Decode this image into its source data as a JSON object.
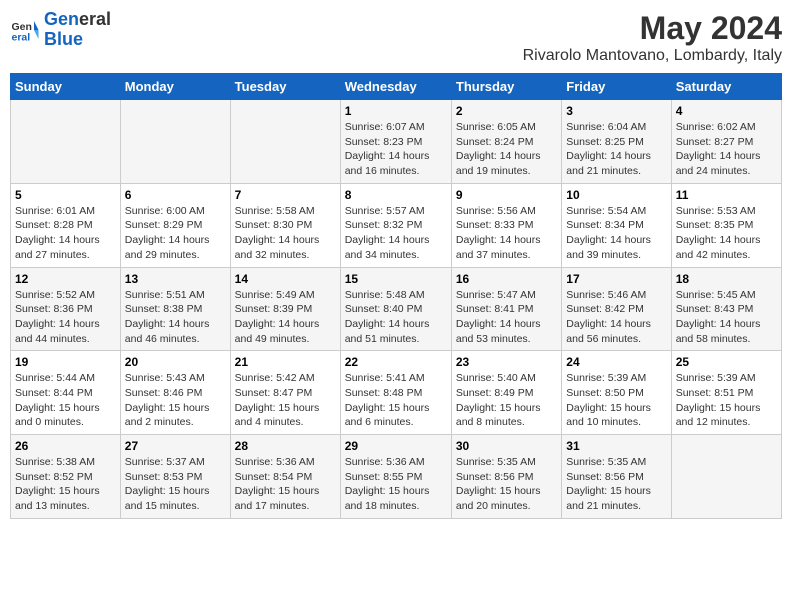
{
  "logo": {
    "line1": "General",
    "line2": "Blue"
  },
  "title": "May 2024",
  "subtitle": "Rivarolo Mantovano, Lombardy, Italy",
  "headers": [
    "Sunday",
    "Monday",
    "Tuesday",
    "Wednesday",
    "Thursday",
    "Friday",
    "Saturday"
  ],
  "rows": [
    [
      {
        "day": "",
        "info": ""
      },
      {
        "day": "",
        "info": ""
      },
      {
        "day": "",
        "info": ""
      },
      {
        "day": "1",
        "info": "Sunrise: 6:07 AM\nSunset: 8:23 PM\nDaylight: 14 hours\nand 16 minutes."
      },
      {
        "day": "2",
        "info": "Sunrise: 6:05 AM\nSunset: 8:24 PM\nDaylight: 14 hours\nand 19 minutes."
      },
      {
        "day": "3",
        "info": "Sunrise: 6:04 AM\nSunset: 8:25 PM\nDaylight: 14 hours\nand 21 minutes."
      },
      {
        "day": "4",
        "info": "Sunrise: 6:02 AM\nSunset: 8:27 PM\nDaylight: 14 hours\nand 24 minutes."
      }
    ],
    [
      {
        "day": "5",
        "info": "Sunrise: 6:01 AM\nSunset: 8:28 PM\nDaylight: 14 hours\nand 27 minutes."
      },
      {
        "day": "6",
        "info": "Sunrise: 6:00 AM\nSunset: 8:29 PM\nDaylight: 14 hours\nand 29 minutes."
      },
      {
        "day": "7",
        "info": "Sunrise: 5:58 AM\nSunset: 8:30 PM\nDaylight: 14 hours\nand 32 minutes."
      },
      {
        "day": "8",
        "info": "Sunrise: 5:57 AM\nSunset: 8:32 PM\nDaylight: 14 hours\nand 34 minutes."
      },
      {
        "day": "9",
        "info": "Sunrise: 5:56 AM\nSunset: 8:33 PM\nDaylight: 14 hours\nand 37 minutes."
      },
      {
        "day": "10",
        "info": "Sunrise: 5:54 AM\nSunset: 8:34 PM\nDaylight: 14 hours\nand 39 minutes."
      },
      {
        "day": "11",
        "info": "Sunrise: 5:53 AM\nSunset: 8:35 PM\nDaylight: 14 hours\nand 42 minutes."
      }
    ],
    [
      {
        "day": "12",
        "info": "Sunrise: 5:52 AM\nSunset: 8:36 PM\nDaylight: 14 hours\nand 44 minutes."
      },
      {
        "day": "13",
        "info": "Sunrise: 5:51 AM\nSunset: 8:38 PM\nDaylight: 14 hours\nand 46 minutes."
      },
      {
        "day": "14",
        "info": "Sunrise: 5:49 AM\nSunset: 8:39 PM\nDaylight: 14 hours\nand 49 minutes."
      },
      {
        "day": "15",
        "info": "Sunrise: 5:48 AM\nSunset: 8:40 PM\nDaylight: 14 hours\nand 51 minutes."
      },
      {
        "day": "16",
        "info": "Sunrise: 5:47 AM\nSunset: 8:41 PM\nDaylight: 14 hours\nand 53 minutes."
      },
      {
        "day": "17",
        "info": "Sunrise: 5:46 AM\nSunset: 8:42 PM\nDaylight: 14 hours\nand 56 minutes."
      },
      {
        "day": "18",
        "info": "Sunrise: 5:45 AM\nSunset: 8:43 PM\nDaylight: 14 hours\nand 58 minutes."
      }
    ],
    [
      {
        "day": "19",
        "info": "Sunrise: 5:44 AM\nSunset: 8:44 PM\nDaylight: 15 hours\nand 0 minutes."
      },
      {
        "day": "20",
        "info": "Sunrise: 5:43 AM\nSunset: 8:46 PM\nDaylight: 15 hours\nand 2 minutes."
      },
      {
        "day": "21",
        "info": "Sunrise: 5:42 AM\nSunset: 8:47 PM\nDaylight: 15 hours\nand 4 minutes."
      },
      {
        "day": "22",
        "info": "Sunrise: 5:41 AM\nSunset: 8:48 PM\nDaylight: 15 hours\nand 6 minutes."
      },
      {
        "day": "23",
        "info": "Sunrise: 5:40 AM\nSunset: 8:49 PM\nDaylight: 15 hours\nand 8 minutes."
      },
      {
        "day": "24",
        "info": "Sunrise: 5:39 AM\nSunset: 8:50 PM\nDaylight: 15 hours\nand 10 minutes."
      },
      {
        "day": "25",
        "info": "Sunrise: 5:39 AM\nSunset: 8:51 PM\nDaylight: 15 hours\nand 12 minutes."
      }
    ],
    [
      {
        "day": "26",
        "info": "Sunrise: 5:38 AM\nSunset: 8:52 PM\nDaylight: 15 hours\nand 13 minutes."
      },
      {
        "day": "27",
        "info": "Sunrise: 5:37 AM\nSunset: 8:53 PM\nDaylight: 15 hours\nand 15 minutes."
      },
      {
        "day": "28",
        "info": "Sunrise: 5:36 AM\nSunset: 8:54 PM\nDaylight: 15 hours\nand 17 minutes."
      },
      {
        "day": "29",
        "info": "Sunrise: 5:36 AM\nSunset: 8:55 PM\nDaylight: 15 hours\nand 18 minutes."
      },
      {
        "day": "30",
        "info": "Sunrise: 5:35 AM\nSunset: 8:56 PM\nDaylight: 15 hours\nand 20 minutes."
      },
      {
        "day": "31",
        "info": "Sunrise: 5:35 AM\nSunset: 8:56 PM\nDaylight: 15 hours\nand 21 minutes."
      },
      {
        "day": "",
        "info": ""
      }
    ]
  ]
}
